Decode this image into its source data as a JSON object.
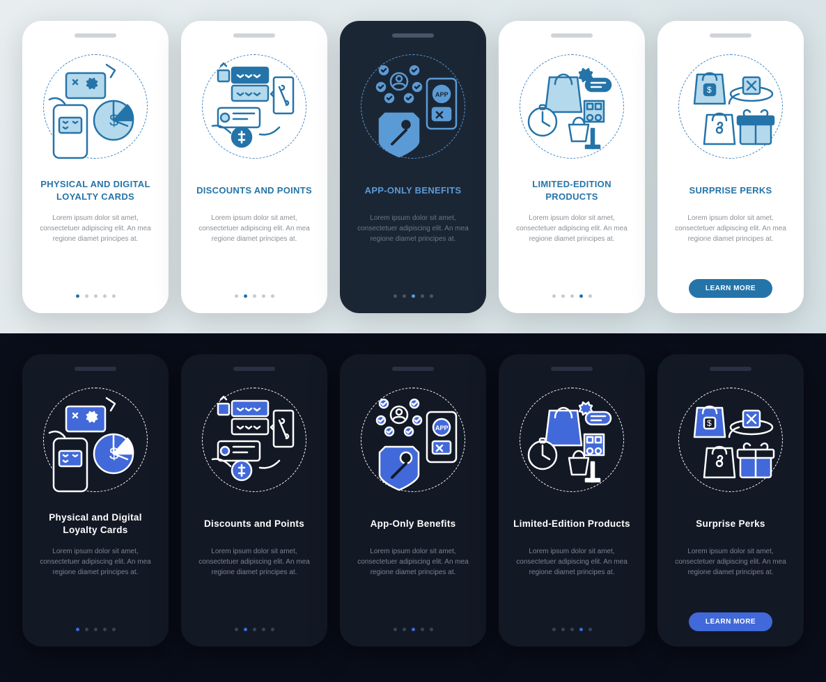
{
  "lorem": "Lorem ipsum dolor sit amet, consectetuer adipiscing elit. An mea regione diamet principes at.",
  "button": "LEARN MORE",
  "light": {
    "cards": [
      {
        "title": "PHYSICAL AND DIGITAL LOYALTY CARDS",
        "active": 0
      },
      {
        "title": "DISCOUNTS AND POINTS",
        "active": 1
      },
      {
        "title": "APP-ONLY BENEFITS",
        "active": 2
      },
      {
        "title": "LIMITED-EDITION PRODUCTS",
        "active": 3
      },
      {
        "title": "SURPRISE PERKS",
        "active": 4
      }
    ]
  },
  "dark": {
    "cards": [
      {
        "title": "Physical and Digital Loyalty Cards",
        "active": 0
      },
      {
        "title": "Discounts and Points",
        "active": 1
      },
      {
        "title": "App-Only Benefits",
        "active": 2
      },
      {
        "title": "Limited-Edition Products",
        "active": 3
      },
      {
        "title": "Surprise Perks",
        "active": 4
      }
    ]
  },
  "colors": {
    "lightAccent": "#2574a9",
    "lightFill": "#b5d9ec",
    "darkAccent": "#4169d9",
    "darkStroke": "#fff"
  }
}
